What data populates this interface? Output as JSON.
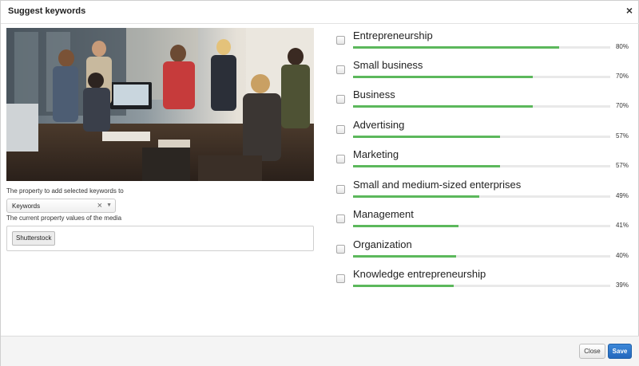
{
  "dialog": {
    "title": "Suggest keywords",
    "close_glyph": "×"
  },
  "photo": {
    "description_icon": "photo-image"
  },
  "property": {
    "label": "The property to add selected keywords to",
    "selected": "Keywords",
    "clear_glyph": "×",
    "arrow_glyph": "▼"
  },
  "current": {
    "label": "The current property values of the media",
    "tags": [
      "Shutterstock"
    ]
  },
  "keywords": [
    {
      "name": "Entrepreneurship",
      "percent": "80%",
      "value": 80
    },
    {
      "name": "Small business",
      "percent": "70%",
      "value": 70
    },
    {
      "name": "Business",
      "percent": "70%",
      "value": 70
    },
    {
      "name": "Advertising",
      "percent": "57%",
      "value": 57
    },
    {
      "name": "Marketing",
      "percent": "57%",
      "value": 57
    },
    {
      "name": "Small and medium-sized enterprises",
      "percent": "49%",
      "value": 49
    },
    {
      "name": "Management",
      "percent": "41%",
      "value": 41
    },
    {
      "name": "Organization",
      "percent": "40%",
      "value": 40
    },
    {
      "name": "Knowledge entrepreneurship",
      "percent": "39%",
      "value": 39
    }
  ],
  "footer": {
    "close_label": "Close",
    "save_label": "Save"
  },
  "colors": {
    "progress": "#5cb85c",
    "primary": "#2468bd"
  }
}
